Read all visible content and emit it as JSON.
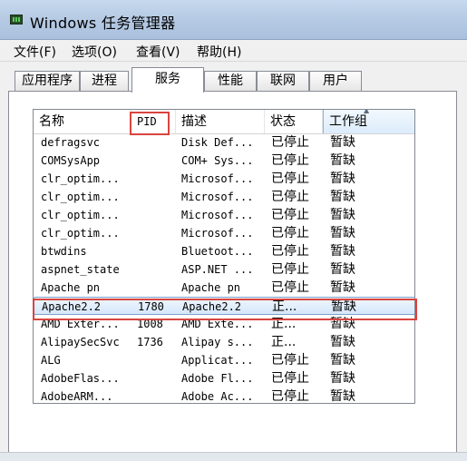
{
  "window": {
    "title": "Windows 任务管理器",
    "icon": "task-manager-icon"
  },
  "menu": [
    "文件(F)",
    "选项(O)",
    "查看(V)",
    "帮助(H)"
  ],
  "tabs": [
    {
      "label": "应用程序",
      "active": false
    },
    {
      "label": "进程",
      "active": false
    },
    {
      "label": "服务",
      "active": true
    },
    {
      "label": "性能",
      "active": false
    },
    {
      "label": "联网",
      "active": false
    },
    {
      "label": "用户",
      "active": false
    }
  ],
  "columns": [
    "名称",
    "PID",
    "描述",
    "状态",
    "工作组"
  ],
  "sorted_column": "工作组",
  "rows": [
    {
      "name": "defragsvc",
      "pid": "",
      "desc": "Disk Def...",
      "status": "已停止",
      "group": "暂缺"
    },
    {
      "name": "COMSysApp",
      "pid": "",
      "desc": "COM+ Sys...",
      "status": "已停止",
      "group": "暂缺"
    },
    {
      "name": "clr_optim...",
      "pid": "",
      "desc": "Microsof...",
      "status": "已停止",
      "group": "暂缺"
    },
    {
      "name": "clr_optim...",
      "pid": "",
      "desc": "Microsof...",
      "status": "已停止",
      "group": "暂缺"
    },
    {
      "name": "clr_optim...",
      "pid": "",
      "desc": "Microsof...",
      "status": "已停止",
      "group": "暂缺"
    },
    {
      "name": "clr_optim...",
      "pid": "",
      "desc": "Microsof...",
      "status": "已停止",
      "group": "暂缺"
    },
    {
      "name": "btwdins",
      "pid": "",
      "desc": "Bluetoot...",
      "status": "已停止",
      "group": "暂缺"
    },
    {
      "name": "aspnet_state",
      "pid": "",
      "desc": "ASP.NET ...",
      "status": "已停止",
      "group": "暂缺"
    },
    {
      "name": "Apache pn",
      "pid": "",
      "desc": "Apache pn",
      "status": "已停止",
      "group": "暂缺"
    },
    {
      "name": "Apache2.2",
      "pid": "1780",
      "desc": "Apache2.2",
      "status": "正...",
      "group": "暂缺",
      "selected": true
    },
    {
      "name": "AMD Exter...",
      "pid": "1008",
      "desc": "AMD Exte...",
      "status": "正...",
      "group": "暂缺"
    },
    {
      "name": "AlipaySecSvc",
      "pid": "1736",
      "desc": "Alipay s...",
      "status": "正...",
      "group": "暂缺"
    },
    {
      "name": "ALG",
      "pid": "",
      "desc": "Applicat...",
      "status": "已停止",
      "group": "暂缺"
    },
    {
      "name": "AdobeFlas...",
      "pid": "",
      "desc": "Adobe Fl...",
      "status": "已停止",
      "group": "暂缺"
    },
    {
      "name": "AdobeARM...",
      "pid": "",
      "desc": "Adobe Ac...",
      "status": "已停止",
      "group": "暂缺"
    }
  ],
  "colors": {
    "titlebar": "#b7cbe4",
    "selection": "#d5e7fb",
    "annotation": "#d9443f"
  }
}
